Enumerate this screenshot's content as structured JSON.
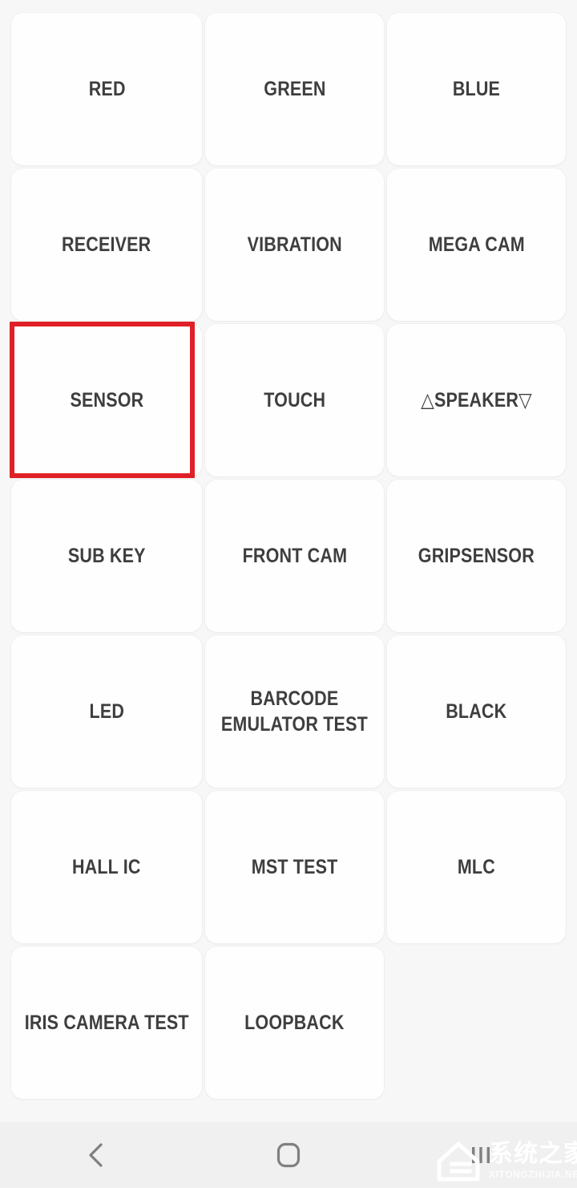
{
  "theme": {
    "page_background": "#f2f2f2",
    "grid_background": "#f7f7f7",
    "card_background": "#fefefe",
    "label_color": "#3e3e3e",
    "highlight_color": "#e01f26",
    "navbar_background": "#f0f0f0",
    "navbar_icon_color": "#808080"
  },
  "grid": {
    "columns": 3,
    "rows": 7,
    "cells": [
      {
        "label": "RED",
        "highlighted": false,
        "wrap": false
      },
      {
        "label": "GREEN",
        "highlighted": false,
        "wrap": false
      },
      {
        "label": "BLUE",
        "highlighted": false,
        "wrap": false
      },
      {
        "label": "RECEIVER",
        "highlighted": false,
        "wrap": false
      },
      {
        "label": "VIBRATION",
        "highlighted": false,
        "wrap": false
      },
      {
        "label": "MEGA CAM",
        "highlighted": false,
        "wrap": false
      },
      {
        "label": "SENSOR",
        "highlighted": true,
        "wrap": false
      },
      {
        "label": "TOUCH",
        "highlighted": false,
        "wrap": false
      },
      {
        "label": "△SPEAKER▽",
        "highlighted": false,
        "wrap": false
      },
      {
        "label": "SUB KEY",
        "highlighted": false,
        "wrap": false
      },
      {
        "label": "FRONT CAM",
        "highlighted": false,
        "wrap": false
      },
      {
        "label": "GRIPSENSOR",
        "highlighted": false,
        "wrap": false
      },
      {
        "label": "LED",
        "highlighted": false,
        "wrap": false
      },
      {
        "label": "BARCODE EMULATOR TEST",
        "highlighted": false,
        "wrap": true
      },
      {
        "label": "BLACK",
        "highlighted": false,
        "wrap": false
      },
      {
        "label": "HALL IC",
        "highlighted": false,
        "wrap": false
      },
      {
        "label": "MST TEST",
        "highlighted": false,
        "wrap": false
      },
      {
        "label": "MLC",
        "highlighted": false,
        "wrap": false
      },
      {
        "label": "IRIS CAMERA TEST",
        "highlighted": false,
        "wrap": false
      },
      {
        "label": "LOOPBACK",
        "highlighted": false,
        "wrap": false
      },
      {
        "label": "",
        "highlighted": false,
        "wrap": false,
        "empty": true
      }
    ]
  },
  "navbar": {
    "buttons": [
      {
        "name": "back",
        "icon": "chevron-left-icon"
      },
      {
        "name": "home",
        "icon": "rounded-square-icon"
      },
      {
        "name": "recents",
        "icon": "recents-bars-icon"
      }
    ]
  },
  "watermark": {
    "chinese": "系统之家",
    "english": "XITONGZHIJIA.NET"
  }
}
